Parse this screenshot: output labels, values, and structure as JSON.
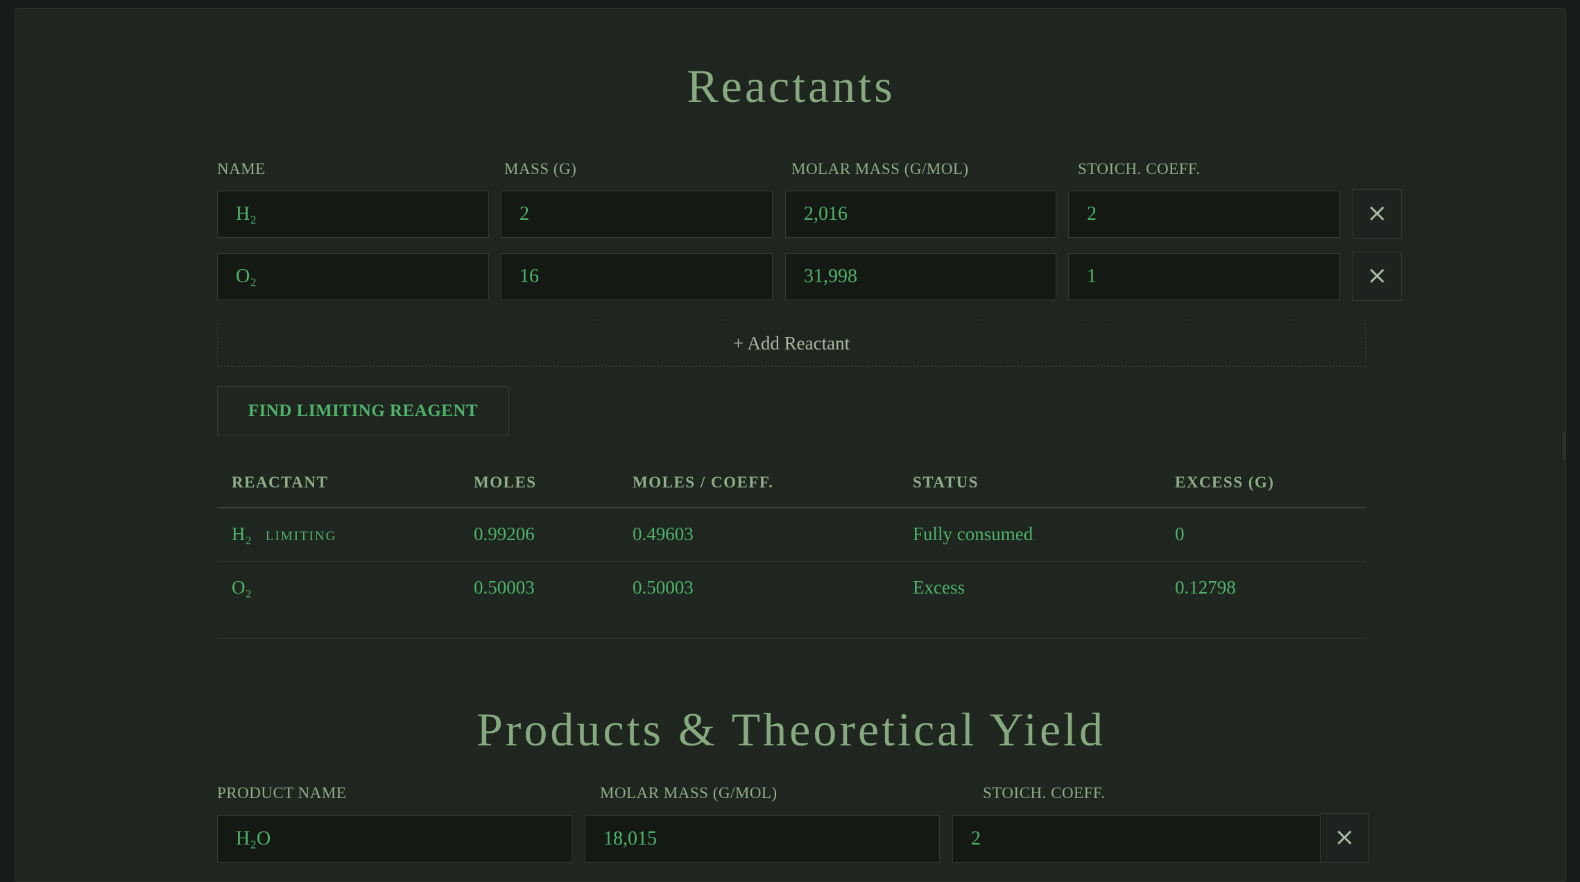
{
  "reactants": {
    "title": "Reactants",
    "labels": {
      "name": "NAME",
      "mass": "MASS (G)",
      "molar_mass": "MOLAR MASS (G/MOL)",
      "coeff": "STOICH. COEFF."
    },
    "rows": [
      {
        "name": "H₂",
        "mass": "2",
        "molar_mass": "2,016",
        "coeff": "2",
        "remove": "×"
      },
      {
        "name": "O₂",
        "mass": "16",
        "molar_mass": "31,998",
        "coeff": "1",
        "remove": "×"
      }
    ],
    "add_label": "+ Add Reactant",
    "find_label": "FIND LIMITING REAGENT"
  },
  "results": {
    "headers": [
      "REACTANT",
      "MOLES",
      "MOLES / COEFF.",
      "STATUS",
      "EXCESS (G)"
    ],
    "rows": [
      {
        "reactant": "H₂",
        "badge": "LIMITING",
        "moles": "0.99206",
        "moles_coeff": "0.49603",
        "status": "Fully consumed",
        "excess": "0"
      },
      {
        "reactant": "O₂",
        "badge": "",
        "moles": "0.50003",
        "moles_coeff": "0.50003",
        "status": "Excess",
        "excess": "0.12798"
      }
    ]
  },
  "products": {
    "title": "Products & Theoretical Yield",
    "labels": {
      "name": "PRODUCT NAME",
      "molar_mass": "MOLAR MASS (G/MOL)",
      "coeff": "STOICH. COEFF."
    },
    "rows": [
      {
        "name": "H₂O",
        "molar_mass": "18,015",
        "coeff": "2",
        "remove": "×"
      }
    ]
  },
  "colors": {
    "background": "#1f251f",
    "accent_green": "#4fb36b",
    "title_green": "#86a97f"
  }
}
